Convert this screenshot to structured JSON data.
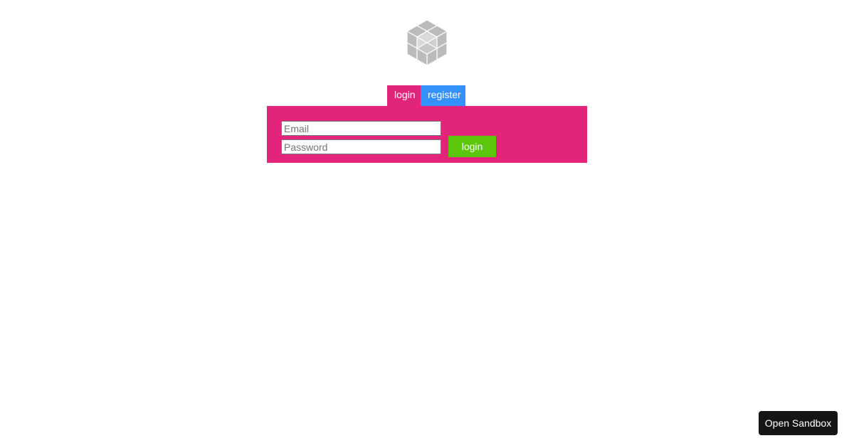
{
  "logo": {
    "icon": "cube-logo-icon",
    "color": "#bbbbbb"
  },
  "tabs": [
    {
      "label": "login",
      "color": "#e2257a",
      "active": true
    },
    {
      "label": "register",
      "color": "#3391fc",
      "active": false
    }
  ],
  "form": {
    "panel_color": "#e2257a",
    "email_placeholder": "Email",
    "password_placeholder": "Password",
    "submit_label": "login",
    "submit_color": "#5cc60b"
  },
  "sandbox": {
    "label": "Open Sandbox",
    "color": "#151515"
  }
}
